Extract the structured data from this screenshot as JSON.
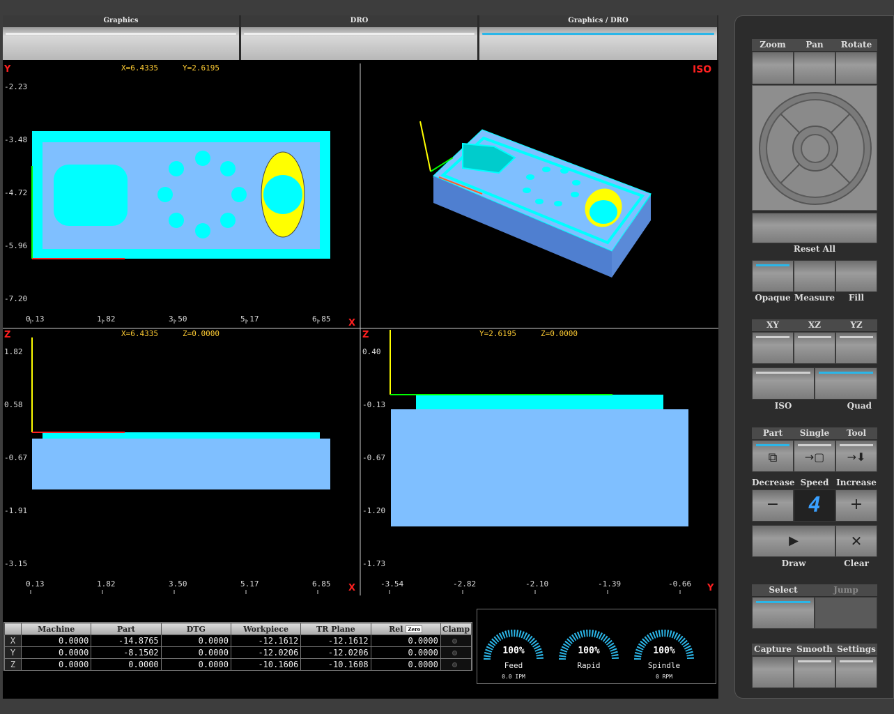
{
  "tabs": [
    {
      "label": "Graphics",
      "active": false
    },
    {
      "label": "DRO",
      "active": false
    },
    {
      "label": "Graphics / DRO",
      "active": true
    }
  ],
  "views": {
    "xy": {
      "axis_v": "Y",
      "axis_h": "X",
      "coords": [
        "X=6.4335",
        "Y=2.6195"
      ],
      "v_ticks": [
        "-2.23",
        "-3.48",
        "-4.72",
        "-5.96",
        "-7.20"
      ],
      "h_ticks": [
        "0.13",
        "1.82",
        "3.50",
        "5.17",
        "6.85"
      ]
    },
    "iso": {
      "label": "ISO"
    },
    "xz": {
      "axis_v": "Z",
      "axis_h": "X",
      "coords": [
        "X=6.4335",
        "Z=0.0000"
      ],
      "v_ticks": [
        "1.82",
        "0.58",
        "-0.67",
        "-1.91",
        "-3.15"
      ],
      "h_ticks": [
        "0.13",
        "1.82",
        "3.50",
        "5.17",
        "6.85"
      ]
    },
    "yz": {
      "axis_v": "Z",
      "axis_h": "Y",
      "coords": [
        "Y=2.6195",
        "Z=0.0000"
      ],
      "v_ticks": [
        "0.40",
        "-0.13",
        "-0.67",
        "-1.20",
        "-1.73"
      ],
      "h_ticks": [
        "-3.54",
        "-2.82",
        "-2.10",
        "-1.39",
        "-0.66"
      ]
    }
  },
  "dro": {
    "headers": [
      "",
      "Machine",
      "Part",
      "DTG",
      "Workpiece",
      "TR Plane",
      "Rel",
      "Clamp"
    ],
    "zero_label": "Zero",
    "rows": [
      {
        "axis": "X",
        "values": [
          "0.0000",
          "-14.8765",
          "0.0000",
          "-12.1612",
          "-12.1612",
          "0.0000"
        ]
      },
      {
        "axis": "Y",
        "values": [
          "0.0000",
          "-8.1502",
          "0.0000",
          "-12.0206",
          "-12.0206",
          "0.0000"
        ]
      },
      {
        "axis": "Z",
        "values": [
          "0.0000",
          "0.0000",
          "0.0000",
          "-10.1606",
          "-10.1608",
          "0.0000"
        ]
      }
    ]
  },
  "gauges": [
    {
      "pct": "100%",
      "name": "Feed",
      "sub": "0.0 IPM",
      "level": 1.0
    },
    {
      "pct": "100%",
      "name": "Rapid",
      "sub": "",
      "level": 1.0
    },
    {
      "pct": "100%",
      "name": "Spindle",
      "sub": "0 RPM",
      "level": 1.0
    }
  ],
  "panel": {
    "nav": {
      "zoom": "Zoom",
      "pan": "Pan",
      "rotate": "Rotate",
      "reset": "Reset All"
    },
    "display": {
      "opaque": "Opaque",
      "measure": "Measure",
      "fill": "Fill"
    },
    "planes": {
      "xy": "XY",
      "xz": "XZ",
      "yz": "YZ",
      "iso": "ISO",
      "quad": "Quad"
    },
    "follow": {
      "part": "Part",
      "single": "Single",
      "tool": "Tool"
    },
    "speed": {
      "decrease": "Decrease",
      "speed": "Speed",
      "increase": "Increase",
      "value": "4",
      "draw": "Draw",
      "clear": "Clear"
    },
    "select": {
      "select": "Select",
      "jump": "Jump"
    },
    "misc": {
      "capture": "Capture",
      "smooth": "Smooth",
      "settings": "Settings"
    }
  },
  "colors": {
    "part": "#7fbfff",
    "pocket": "#00ffff",
    "accent": "#2bb6e8",
    "bore": "#ffff00"
  }
}
